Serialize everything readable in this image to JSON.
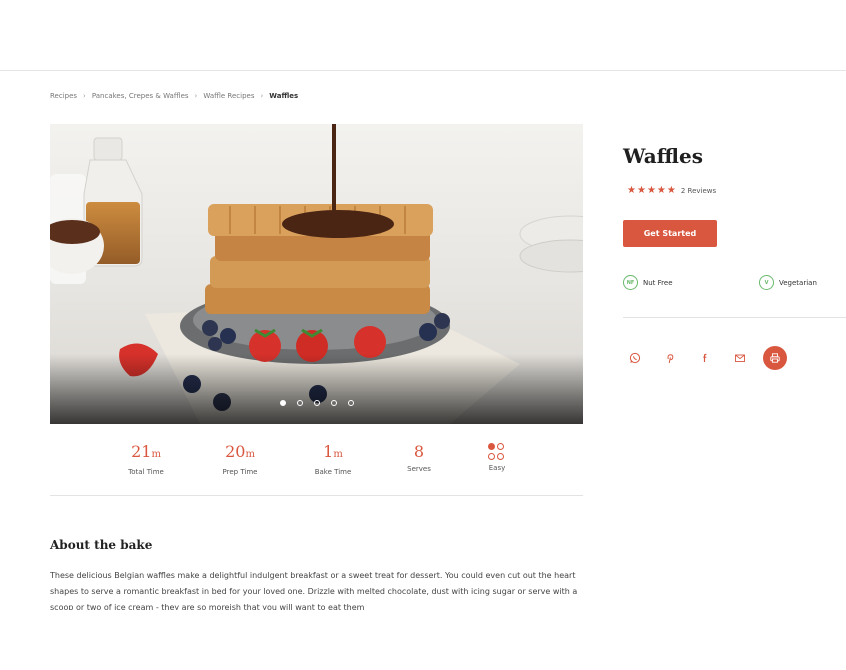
{
  "breadcrumb": {
    "items": [
      "Recipes",
      "Pancakes, Crepes & Waffles",
      "Waffle Recipes"
    ],
    "current": "Waffles",
    "separator": "›"
  },
  "recipe": {
    "title": "Waffles",
    "rating": 5,
    "reviews_label": "2 Reviews",
    "cta_label": "Get Started"
  },
  "tags": [
    {
      "code": "NF",
      "label": "Nut Free"
    },
    {
      "code": "V",
      "label": "Vegetarian"
    }
  ],
  "carousel": {
    "slide_count": 5,
    "active_index": 0
  },
  "stats": [
    {
      "value": "21",
      "unit": "m",
      "label": "Total Time"
    },
    {
      "value": "20",
      "unit": "m",
      "label": "Prep Time"
    },
    {
      "value": "1",
      "unit": "m",
      "label": "Bake Time"
    },
    {
      "value": "8",
      "unit": "",
      "label": "Serves"
    },
    {
      "value": "",
      "unit": "",
      "label": "Easy",
      "icon": "difficulty-dots-icon"
    }
  ],
  "about": {
    "title": "About the bake",
    "text": "These delicious Belgian waffles make a delightful indulgent breakfast or a sweet treat for dessert. You could even cut out the heart shapes to serve a romantic breakfast in bed for your loved one. Drizzle with melted chocolate, dust with icing sugar or serve with a scoop or two of ice cream - they are so moreish that you will want to eat them"
  },
  "share": [
    "whatsapp-icon",
    "pinterest-icon",
    "facebook-icon",
    "email-icon",
    "print-icon"
  ],
  "colors": {
    "accent": "#d9573f",
    "tag_green": "#69b86b",
    "divider": "#e3e3e3"
  }
}
